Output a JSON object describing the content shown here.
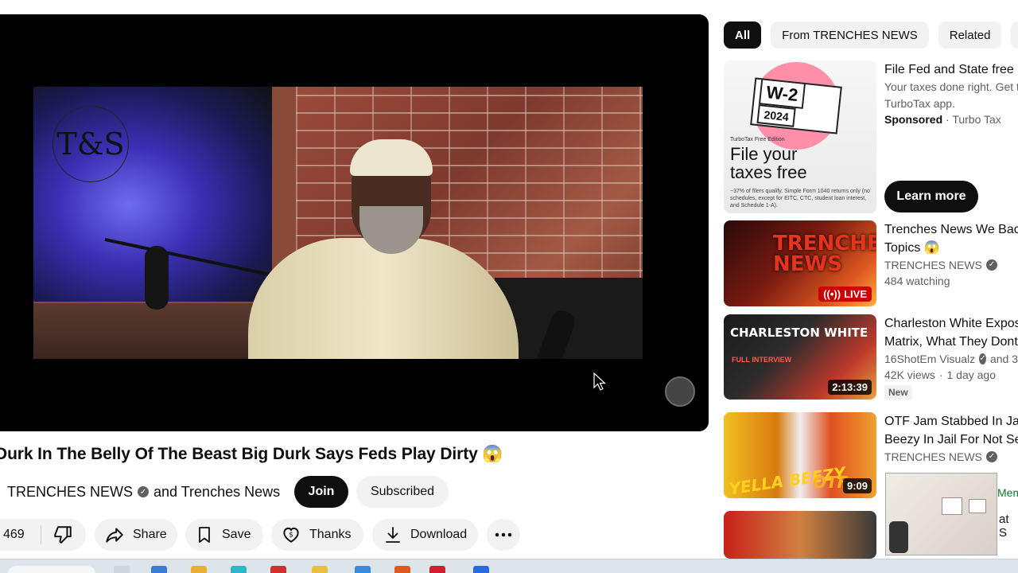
{
  "video": {
    "title": "Durk In The Belly Of The Beast Big Durk Says Feds Play Dirty 😱",
    "channel": "TRENCHES NEWS",
    "channel_collab": "and Trenches News",
    "logo_text": "T&S",
    "join_label": "Join",
    "subscribed_label": "Subscribed"
  },
  "actions": {
    "likes": "469",
    "share": "Share",
    "save": "Save",
    "thanks": "Thanks",
    "download": "Download"
  },
  "chips": [
    "All",
    "From TRENCHES NEWS",
    "Related"
  ],
  "ad": {
    "title": "File Fed and State free",
    "desc1": "Your taxes done right. Get th",
    "desc2": "TurboTax app.",
    "sponsored": "Sponsored",
    "advertiser": "Turbo Tax",
    "cta": "Learn more",
    "thumb_badge": "W-2",
    "thumb_year": "2024",
    "thumb_small": "TurboTax Free Edition",
    "thumb_big1": "File your",
    "thumb_big2": "taxes free",
    "thumb_fine": "~37% of filers qualify. Simple Form 1040 returns only (no schedules, except for EITC, CTC, student loan interest, and Schedule 1-A)."
  },
  "recommendations": [
    {
      "title_line1": "Trenches News We Bac",
      "title_line2": "Topics 😱",
      "channel": "TRENCHES NEWS",
      "meta": "484 watching",
      "badge": "LIVE",
      "thumb_text": "TRENCHES NEWS"
    },
    {
      "title_line1": "Charleston White Expos",
      "title_line2": "Matrix, What They Dont",
      "channel": "16ShotEm Visualz",
      "channel_extra": "and 3",
      "views": "42K views",
      "age": "1 day ago",
      "tag": "New",
      "badge": "2:13:39",
      "thumb_text": "CHARLESTON WHITE",
      "thumb_sub": "FULL INTERVIEW"
    },
    {
      "title_line1": "OTF Jam Stabbed In Ja",
      "title_line2": "Beezy In Jail For Not Se",
      "channel": "TRENCHES NEWS",
      "badge": "9:09",
      "thumb_text": "YELLA BEEZY",
      "thumb_text2": "OTF"
    }
  ],
  "peek": {
    "member": "Mem",
    "text": "at S"
  },
  "colors": {
    "live_red": "#cc0000",
    "join_bg": "#0f0f0f",
    "chip_bg": "#f2f2f2"
  }
}
